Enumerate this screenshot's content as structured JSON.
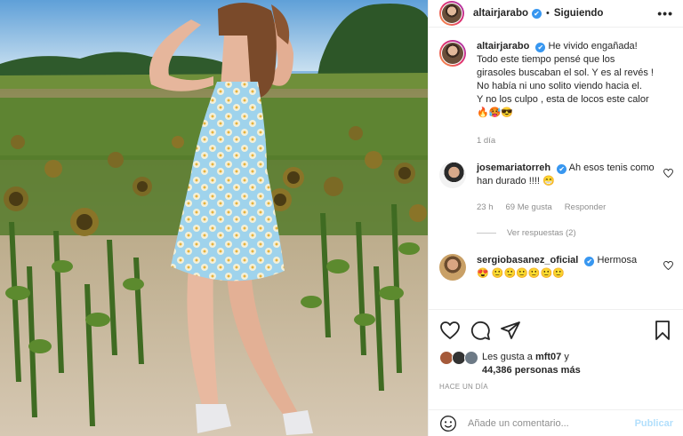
{
  "post": {
    "author": "altairjarabo",
    "follow_status": "Siguiendo",
    "more_glyph": "•••",
    "separator": "•",
    "verified_glyph": "✔",
    "caption": {
      "line1": "He vivido engañada! Todo este tiempo pensé que los girasoles buscaban el sol. Y es al revés ! No había ni uno solito viendo hacia el.",
      "line2": "Y no los culpo , esta de locos este calor",
      "emojis": "🔥🥵😎"
    },
    "caption_time": "1 día"
  },
  "comments": [
    {
      "user": "josemariatorreh",
      "text": "Ah esos tenis como han durado !!!! 😁",
      "time": "23 h",
      "likes": "69 Me gusta",
      "reply": "Responder",
      "view_replies": "Ver respuestas (2)"
    },
    {
      "user": "sergiobasanez_oficial",
      "text": "Hermosa",
      "emojis": "😍 🙂🙂🙂🙂🙂🙂"
    }
  ],
  "likes": {
    "prefix": "Les gusta a",
    "user": "mft07",
    "connector": "y",
    "others": "44,386 personas más",
    "ago": "HACE UN DÍA"
  },
  "composer": {
    "placeholder": "Añade un comentario...",
    "publish": "Publicar"
  },
  "icons": [
    "heart-icon",
    "comment-icon",
    "share-icon",
    "bookmark-icon",
    "emoji-icon",
    "more-icon",
    "verified-icon"
  ],
  "colors": {
    "accent": "#3897f0",
    "publish_disabled": "#b2dffc",
    "muted": "#8e8e8e",
    "text": "#262626"
  }
}
